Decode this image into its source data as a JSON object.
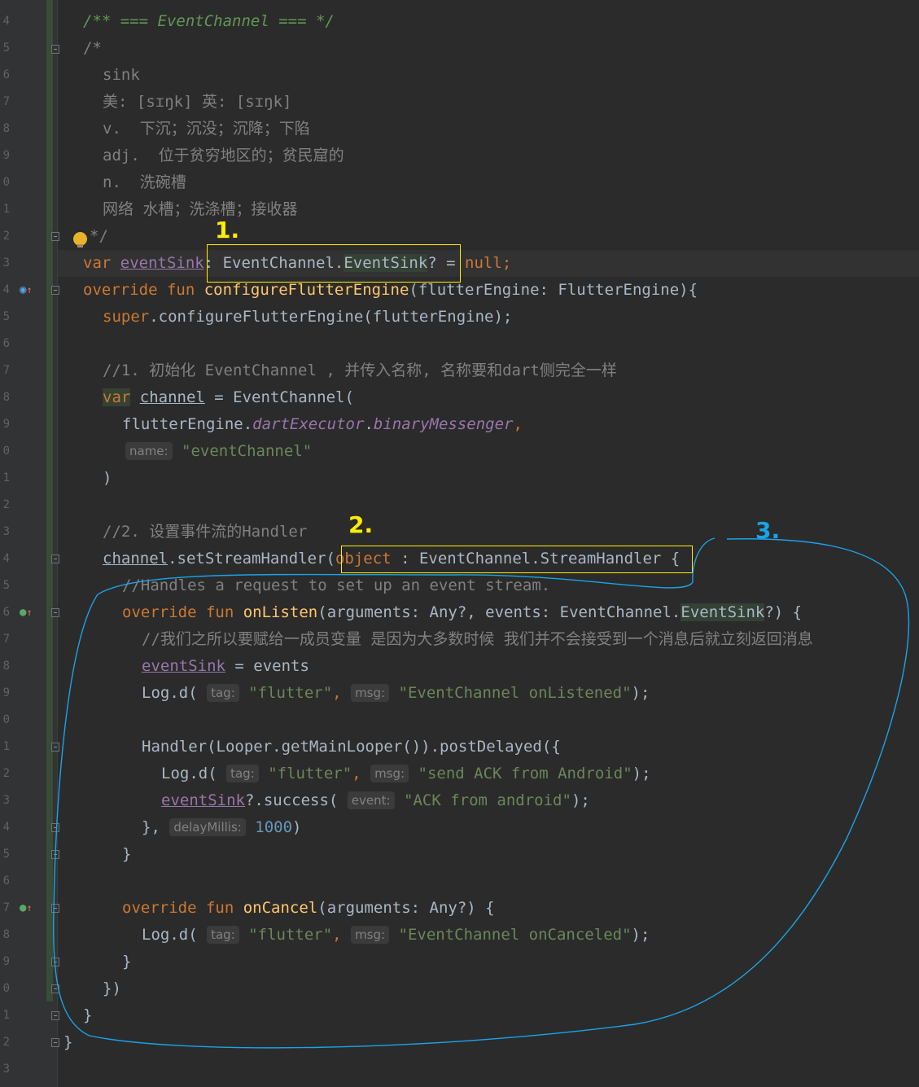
{
  "editor": {
    "line_numbers": [
      "4",
      "5",
      "6",
      "7",
      "8",
      "9",
      "0",
      "1",
      "2",
      "3",
      "4",
      "5",
      "6",
      "7",
      "8",
      "9",
      "0",
      "1",
      "2",
      "3",
      "4",
      "5",
      "6",
      "7",
      "8",
      "9",
      "0",
      "1",
      "2",
      "3",
      "4",
      "5",
      "6",
      "7",
      "8",
      "9",
      "0",
      "1",
      "2",
      "3"
    ],
    "colors": {
      "background": "#2b2b2b",
      "keyword": "#cc7832",
      "string": "#6a8759",
      "function": "#ffc66d",
      "property": "#9876aa",
      "number": "#6897bb",
      "comment": "#808080",
      "annotation_yellow": "#ffee00",
      "annotation_blue": "#1aa3e8"
    }
  },
  "code": {
    "l1": "/** === EventChannel === */",
    "l2": "/*",
    "l3": "sink",
    "l4": "美: [sɪŋk] 英: [sɪŋk]",
    "l5": "v.  下沉；沉没；沉降；下陷",
    "l6": "adj.  位于贫穷地区的；贫民窟的",
    "l7": "n.  洗碗槽",
    "l8": "网络 水槽；洗涤槽；接收器",
    "l9": "*/",
    "l10": {
      "kw": "var",
      "name": "eventSink",
      "rest": ": EventChannel.",
      "type2": "EventSink",
      "rest2": "? = ",
      "kw2": "null",
      "end": ";"
    },
    "l11": {
      "kw": "override fun",
      "fn": "configureFlutterEngine",
      "rest": "(flutterEngine: FlutterEngine){"
    },
    "l12": {
      "kw": "super",
      "rest": ".configureFlutterEngine(flutterEngine);"
    },
    "l14": "//1. 初始化 EventChannel , 并传入名称, 名称要和dart侧完全一样",
    "l15": {
      "kw": "var",
      "name": "channel",
      "rest": " = EventChannel("
    },
    "l16": {
      "a": "flutterEngine.",
      "b": "dartExecutor",
      "c": ".",
      "d": "binaryMessenger",
      "e": ","
    },
    "l17": {
      "hint": "name:",
      "str": "\"eventChannel\""
    },
    "l18": ")",
    "l20": "//2. 设置事件流的Handler",
    "l21": {
      "a": "channel",
      "b": ".setStreamHandler(",
      "kw": "object",
      "c": " : EventChannel.StreamHandler {"
    },
    "l22": "//Handles a request to set up an event stream.",
    "l23": {
      "kw": "override fun",
      "fn": "onListen",
      "a": "(arguments: Any?, events: EventChannel.",
      "b": "EventSink",
      "c": "?) {"
    },
    "l24": "//我们之所以要赋给一成员变量 是因为大多数时候 我们并不会接受到一个消息后就立刻返回消息",
    "l25": {
      "name": "eventSink",
      "rest": " = events"
    },
    "l26": {
      "a": "Log.d(",
      "h1": "tag:",
      "s1": "\"flutter\"",
      "c": ",",
      "h2": "msg:",
      "s2": "\"EventChannel onListened\"",
      "e": ");"
    },
    "l28": "Handler(Looper.getMainLooper()).postDelayed({",
    "l29": {
      "a": "Log.d(",
      "h1": "tag:",
      "s1": "\"flutter\"",
      "c": ",",
      "h2": "msg:",
      "s2": "\"send ACK from Android\"",
      "e": ");"
    },
    "l30": {
      "name": "eventSink",
      "a": "?.success(",
      "h": "event:",
      "s": "\"ACK from android\"",
      "e": ");"
    },
    "l31": {
      "a": "},",
      "h": "delayMillis:",
      "n": "1000",
      "e": ")"
    },
    "l32": "}",
    "l34": {
      "kw": "override fun",
      "fn": "onCancel",
      "a": "(arguments: Any?) {"
    },
    "l35": {
      "a": "Log.d(",
      "h1": "tag:",
      "s1": "\"flutter\"",
      "c": ",",
      "h2": "msg:",
      "s2": "\"EventChannel onCanceled\"",
      "e": ");"
    },
    "l36": "}",
    "l37": "})",
    "l38": "}",
    "l39": "}"
  },
  "annotations": {
    "one": "1.",
    "two": "2.",
    "three": "3."
  },
  "icons": {
    "bulb": "lightbulb-icon",
    "override": "override-gutter-icon",
    "implement": "implement-gutter-icon",
    "fold": "fold-icon"
  }
}
